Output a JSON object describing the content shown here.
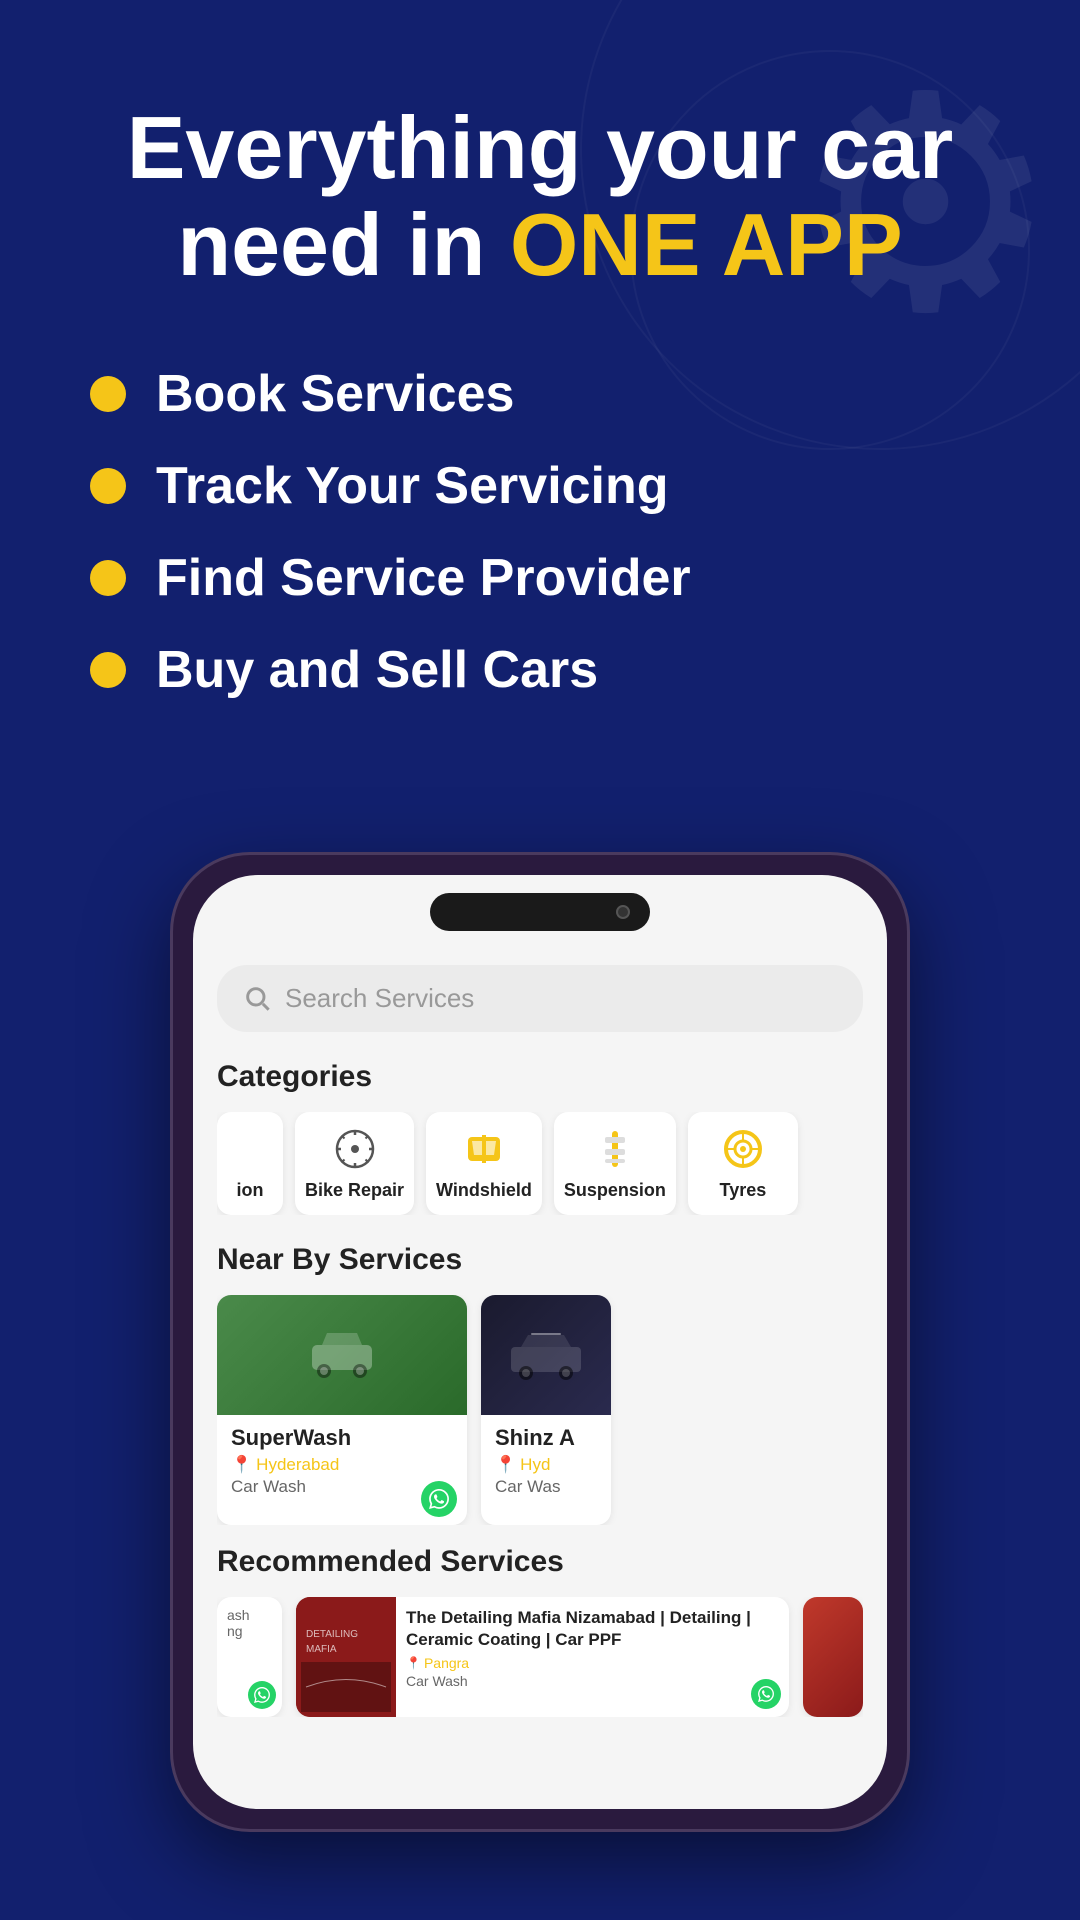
{
  "hero": {
    "title_line1": "Everything your car",
    "title_line2": "need in ",
    "title_highlight": "ONE APP",
    "features": [
      {
        "id": "feature-1",
        "text": "Book Services"
      },
      {
        "id": "feature-2",
        "text": "Track Your Servicing"
      },
      {
        "id": "feature-3",
        "text": "Find Service Provider"
      },
      {
        "id": "feature-4",
        "text": "Buy and Sell Cars"
      }
    ]
  },
  "phone": {
    "search_placeholder": "Search Services",
    "categories_title": "Categories",
    "categories": [
      {
        "id": "cat-partial",
        "label": "ion",
        "icon": "partial"
      },
      {
        "id": "cat-bike-repair",
        "label": "Bike Repair",
        "icon": "gear"
      },
      {
        "id": "cat-windshield",
        "label": "Windshield",
        "icon": "windshield"
      },
      {
        "id": "cat-suspension",
        "label": "Suspension",
        "icon": "suspension"
      },
      {
        "id": "cat-tyres",
        "label": "Tyres",
        "icon": "tyre"
      }
    ],
    "nearby_title": "Near By Services",
    "nearby_cards": [
      {
        "id": "card-superwash",
        "name": "SuperWash",
        "location": "Hyderabad",
        "type": "Car Wash",
        "partial": false
      },
      {
        "id": "card-shinz",
        "name": "Shinz A",
        "location": "Hyd",
        "type": "Car Was",
        "partial": true
      }
    ],
    "recommended_title": "Recommended Services",
    "recommended_cards": [
      {
        "id": "rec-partial-left",
        "name": "ash\ning",
        "location": "",
        "type": "",
        "partial_left": true
      },
      {
        "id": "rec-detailing",
        "name": "The Detailing Mafia Nizamabad | Detailing | Ceramic Coating | Car PPF",
        "location": "Pangra",
        "type": "Car Wash",
        "partial_left": false
      },
      {
        "id": "rec-third",
        "name": "",
        "location": "",
        "type": "",
        "partial_left": false
      }
    ]
  },
  "colors": {
    "bg_dark": "#12206e",
    "accent_yellow": "#f5c518",
    "white": "#ffffff",
    "whatsapp_green": "#25d366"
  }
}
